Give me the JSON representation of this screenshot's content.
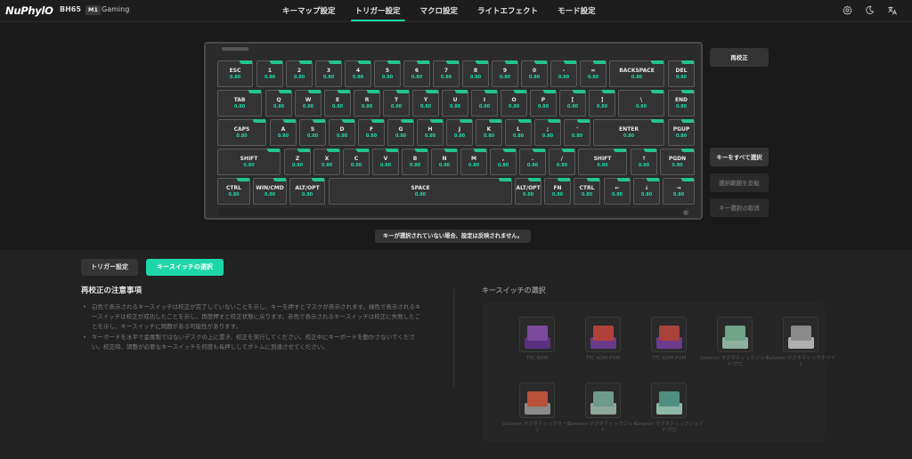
{
  "header": {
    "brand": "NuPhylO",
    "model": "BH65",
    "mode_badge": "M1",
    "mode_name": "Gaming",
    "tabs": [
      {
        "label": "キーマップ設定",
        "active": false
      },
      {
        "label": "トリガー設定",
        "active": true
      },
      {
        "label": "マクロ設定",
        "active": false
      },
      {
        "label": "ライトエフェクト",
        "active": false
      },
      {
        "label": "モード設定",
        "active": false
      }
    ],
    "icons": [
      "gear-icon",
      "moon-icon",
      "translate-icon"
    ],
    "accent_color": "#1ed7a8"
  },
  "keyboard": {
    "rows": [
      [
        {
          "label": "ESC",
          "value": "0.80"
        },
        {
          "label": "1",
          "value": "0.80"
        },
        {
          "label": "2",
          "value": "0.80"
        },
        {
          "label": "3",
          "value": "0.80"
        },
        {
          "label": "4",
          "value": "0.80"
        },
        {
          "label": "5",
          "value": "0.80"
        },
        {
          "label": "6",
          "value": "0.80"
        },
        {
          "label": "7",
          "value": "0.80"
        },
        {
          "label": "8",
          "value": "0.80"
        },
        {
          "label": "9",
          "value": "0.80"
        },
        {
          "label": "0",
          "value": "0.80"
        },
        {
          "label": "-",
          "value": "0.80"
        },
        {
          "label": "=",
          "value": "0.80"
        },
        {
          "label": "BACKSPACE",
          "value": "0.80"
        },
        {
          "label": "DEL",
          "value": "0.80"
        }
      ],
      [
        {
          "label": "TAB",
          "value": "0.80"
        },
        {
          "label": "Q",
          "value": "0.80"
        },
        {
          "label": "W",
          "value": "0.80"
        },
        {
          "label": "E",
          "value": "0.80"
        },
        {
          "label": "R",
          "value": "0.80"
        },
        {
          "label": "T",
          "value": "0.80"
        },
        {
          "label": "Y",
          "value": "0.80"
        },
        {
          "label": "U",
          "value": "0.80"
        },
        {
          "label": "I",
          "value": "0.80"
        },
        {
          "label": "O",
          "value": "0.80"
        },
        {
          "label": "P",
          "value": "0.80"
        },
        {
          "label": "[",
          "value": "0.80"
        },
        {
          "label": "]",
          "value": "0.80"
        },
        {
          "label": "\\",
          "value": "0.80"
        },
        {
          "label": "END",
          "value": "0.80"
        }
      ],
      [
        {
          "label": "CAPS",
          "value": "0.80"
        },
        {
          "label": "A",
          "value": "0.80"
        },
        {
          "label": "S",
          "value": "0.80"
        },
        {
          "label": "D",
          "value": "0.80"
        },
        {
          "label": "F",
          "value": "0.80"
        },
        {
          "label": "G",
          "value": "0.80"
        },
        {
          "label": "H",
          "value": "0.80"
        },
        {
          "label": "J",
          "value": "0.80"
        },
        {
          "label": "K",
          "value": "0.80"
        },
        {
          "label": "L",
          "value": "0.80"
        },
        {
          "label": ";",
          "value": "0.80"
        },
        {
          "label": "'",
          "value": "0.80"
        },
        {
          "label": "ENTER",
          "value": "0.80"
        },
        {
          "label": "PGUP",
          "value": "0.80"
        }
      ],
      [
        {
          "label": "SHIFT",
          "value": "0.80"
        },
        {
          "label": "Z",
          "value": "0.80"
        },
        {
          "label": "X",
          "value": "0.80"
        },
        {
          "label": "C",
          "value": "0.80"
        },
        {
          "label": "V",
          "value": "0.80"
        },
        {
          "label": "B",
          "value": "0.80"
        },
        {
          "label": "N",
          "value": "0.80"
        },
        {
          "label": "M",
          "value": "0.80"
        },
        {
          "label": ",",
          "value": "0.80"
        },
        {
          "label": ".",
          "value": "0.80"
        },
        {
          "label": "/",
          "value": "0.80"
        },
        {
          "label": "SHIFT",
          "value": "0.80"
        },
        {
          "label": "↑",
          "value": "0.80"
        },
        {
          "label": "PGDN",
          "value": "0.80"
        }
      ],
      [
        {
          "label": "CTRL",
          "value": "0.80"
        },
        {
          "label": "WIN/CMD",
          "value": "0.80"
        },
        {
          "label": "ALT/OPT",
          "value": "0.80"
        },
        {
          "label": "SPACE",
          "value": "0.80"
        },
        {
          "label": "ALT/OPT",
          "value": "0.80"
        },
        {
          "label": "FN",
          "value": "0.80"
        },
        {
          "label": "CTRL",
          "value": "0.80"
        },
        {
          "label": "←",
          "value": "0.80"
        },
        {
          "label": "↓",
          "value": "0.80"
        },
        {
          "label": "→",
          "value": "0.80"
        }
      ]
    ]
  },
  "side_actions": {
    "recalibrate": "再校正",
    "select_all": "キーをすべて選択",
    "invert_selection": "選択範囲を反転",
    "deselect": "キー選択の取消"
  },
  "notice": "キーが選択されていない場合、設定は反映されません。",
  "lower": {
    "tab_trigger": "トリガー設定",
    "tab_switch": "キースイッチの選択",
    "notes_title": "再校正の注意事項",
    "notes": [
      "白色で表示されるキースイッチは校正が完了していないことを示し、キーを押すとマスクが表示されます。緑色で表示されるキースイッチは校正が成功したことを示し、再度押すと校正状態に戻ります。赤色で表示されるキースイッチは校正に失敗したことを示し、キースイッチに問題がある可能性があります。",
      "キーボードを水平で金属製ではないデスクの上に置き、校正を実行してください。校正中にキーボードを動かさないでください。校正時、調整が必要なキースイッチを何度も長押ししてボトムに到達させてください。"
    ],
    "switch_title": "キースイッチの選択",
    "switches": [
      {
        "name": "TTC KOM",
        "cap_color": "#7b4a9c",
        "base_color": "#5a2f80"
      },
      {
        "name": "TTC KOM POM",
        "cap_color": "#b0413a",
        "base_color": "#6a3a8a"
      },
      {
        "name": "TTC KOM POM",
        "cap_color": "#a8423a",
        "base_color": "#6d3a8d"
      },
      {
        "name": "Gateron マグネティックジェイドプロ",
        "cap_color": "#6fa38a",
        "base_color": "#8fb0a0"
      },
      {
        "name": "Gateron マグネティックホワイト",
        "cap_color": "#8a8a8a",
        "base_color": "#b0b0b0"
      },
      {
        "name": "Gateron マグネティックオーロラ",
        "cap_color": "#b8523a",
        "base_color": "#8a8a8a"
      },
      {
        "name": "Gateron マグネティックジェイド",
        "cap_color": "#6d9a8a",
        "base_color": "#8fa89c"
      },
      {
        "name": "Gateron マグネティックジェイドプロ",
        "cap_color": "#4f8f80",
        "base_color": "#8fb8a8"
      }
    ]
  }
}
